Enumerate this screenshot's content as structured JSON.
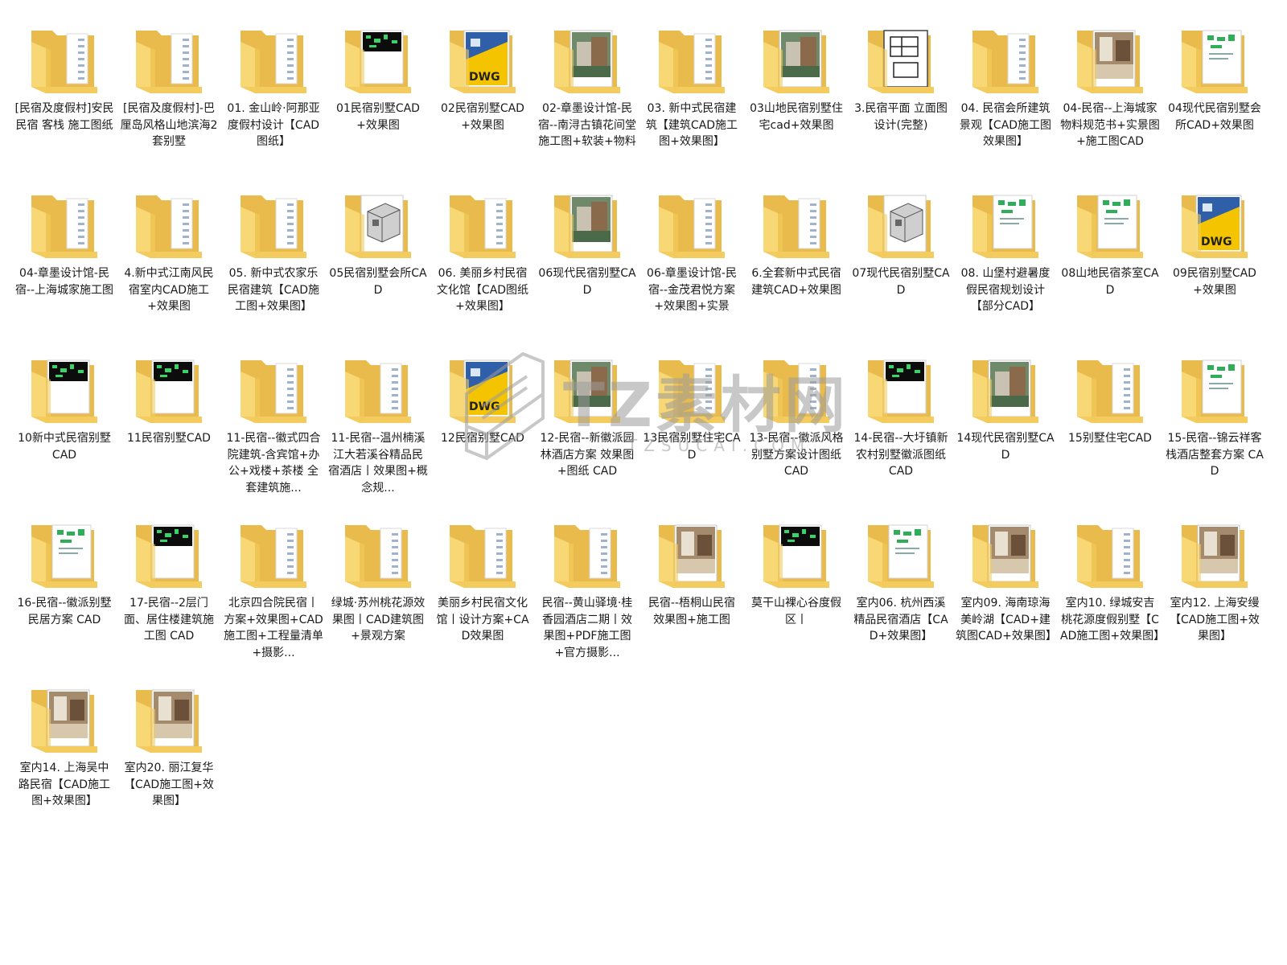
{
  "colors": {
    "folder_back": "#e9bb4d",
    "folder_front": "#f8d775",
    "folder_front_shade": "#f3cb5e",
    "paper": "#ffffff"
  },
  "watermark": {
    "main": "TZ素材网",
    "sub": "TZSUCAI.COM"
  },
  "items": [
    {
      "name": "[民宿及度假村]安民民宿 客栈 施工图纸",
      "preview": "doc"
    },
    {
      "name": "[民宿及度假村]-巴厘岛风格山地滨海2套别墅",
      "preview": "doc"
    },
    {
      "name": "01. 金山岭·阿那亚度假村设计【CAD图纸】",
      "preview": "doc"
    },
    {
      "name": "01民宿别墅CAD+效果图",
      "preview": "cad-dark"
    },
    {
      "name": "02民宿别墅CAD+效果图",
      "preview": "dwg"
    },
    {
      "name": "02-章墨设计馆-民宿--南浔古镇花间堂 施工图+软装+物料",
      "preview": "photo"
    },
    {
      "name": "03. 新中式民宿建筑【建筑CAD施工图+效果图】",
      "preview": "doc"
    },
    {
      "name": "03山地民宿别墅住宅cad+效果图",
      "preview": "photo"
    },
    {
      "name": "3.民宿平面 立面图设计(完整)",
      "preview": "plan"
    },
    {
      "name": "04. 民宿会所建筑景观【CAD施工图效果图】",
      "preview": "doc"
    },
    {
      "name": "04-民宿--上海城家 物料规范书+实景图+施工图CAD",
      "preview": "interior"
    },
    {
      "name": "04现代民宿别墅会所CAD+效果图",
      "preview": "cad-light"
    },
    {
      "name": "04-章墨设计馆-民宿--上海城家施工图",
      "preview": "doc"
    },
    {
      "name": "4.新中式江南风民宿室内CAD施工+效果图",
      "preview": "doc"
    },
    {
      "name": "05. 新中式农家乐民宿建筑【CAD施工图+效果图】",
      "preview": "doc"
    },
    {
      "name": "05民宿别墅会所CAD",
      "preview": "model"
    },
    {
      "name": "06. 美丽乡村民宿文化馆【CAD图纸+效果图】",
      "preview": "doc"
    },
    {
      "name": "06现代民宿别墅CAD",
      "preview": "photo"
    },
    {
      "name": "06-章墨设计馆-民宿--金茂君悦方案+效果图+实景",
      "preview": "doc"
    },
    {
      "name": "6.全套新中式民宿建筑CAD+效果图",
      "preview": "doc"
    },
    {
      "name": "07现代民宿别墅CAD",
      "preview": "model"
    },
    {
      "name": "08. 山堡村避暑度假民宿规划设计【部分CAD】",
      "preview": "cad-light"
    },
    {
      "name": "08山地民宿茶室CAD",
      "preview": "cad-light"
    },
    {
      "name": "09民宿别墅CAD+效果图",
      "preview": "dwg"
    },
    {
      "name": "10新中式民宿别墅CAD",
      "preview": "cad-dark"
    },
    {
      "name": "11民宿别墅CAD",
      "preview": "cad-dark"
    },
    {
      "name": "11-民宿--徽式四合院建筑-含宾馆+办公+戏楼+茶楼 全套建筑施...",
      "preview": "doc"
    },
    {
      "name": "11-民宿--温州楠溪江大若溪谷精品民宿酒店丨效果图+概念规...",
      "preview": "doc"
    },
    {
      "name": "12民宿别墅CAD",
      "preview": "dwg"
    },
    {
      "name": "12-民宿--新徽派园林酒店方案 效果图+图纸 CAD",
      "preview": "photo"
    },
    {
      "name": "13民宿别墅住宅CAD",
      "preview": "doc"
    },
    {
      "name": "13-民宿--徽派风格别墅方案设计图纸 CAD",
      "preview": "doc"
    },
    {
      "name": "14-民宿--大圩镇新农村别墅徽派图纸 CAD",
      "preview": "cad-dark"
    },
    {
      "name": "14现代民宿别墅CAD",
      "preview": "photo"
    },
    {
      "name": "15别墅住宅CAD",
      "preview": "doc"
    },
    {
      "name": "15-民宿--锦云祥客栈酒店整套方案 CAD",
      "preview": "cad-light"
    },
    {
      "name": "16-民宿--徽派别墅民居方案 CAD",
      "preview": "cad-light"
    },
    {
      "name": "17-民宿--2层门面、居住楼建筑施工图 CAD",
      "preview": "cad-dark"
    },
    {
      "name": "北京四合院民宿丨方案+效果图+CAD施工图+工程量清单+摄影...",
      "preview": "doc"
    },
    {
      "name": "绿城·苏州桃花源效果图丨CAD建筑图+景观方案",
      "preview": "doc"
    },
    {
      "name": "美丽乡村民宿文化馆丨设计方案+CAD效果图",
      "preview": "doc"
    },
    {
      "name": "民宿--黄山驿境·桂香园酒店二期丨效果图+PDF施工图+官方摄影...",
      "preview": "doc"
    },
    {
      "name": "民宿--梧桐山民宿 效果图+施工图",
      "preview": "interior"
    },
    {
      "name": "莫干山裸心谷度假区丨",
      "preview": "cad-dark"
    },
    {
      "name": "室内06. 杭州西溪精品民宿酒店【CAD+效果图】",
      "preview": "cad-light"
    },
    {
      "name": "室内09. 海南琼海美岭湖【CAD+建筑图CAD+效果图】",
      "preview": "interior"
    },
    {
      "name": "室内10. 绿城安吉桃花源度假别墅【CAD施工图+效果图】",
      "preview": "doc"
    },
    {
      "name": "室内12. 上海安缦【CAD施工图+效果图】",
      "preview": "interior"
    },
    {
      "name": "室内14. 上海吴中路民宿【CAD施工图+效果图】",
      "preview": "interior"
    },
    {
      "name": "室内20. 丽江复华【CAD施工图+效果图】",
      "preview": "interior"
    }
  ]
}
